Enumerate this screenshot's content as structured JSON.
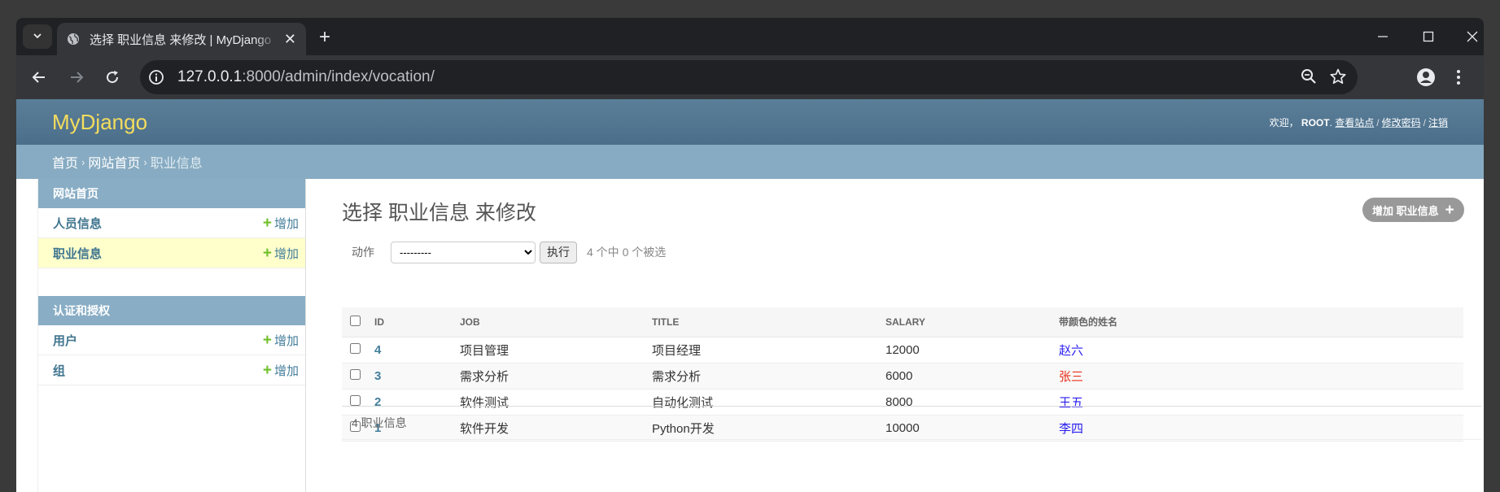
{
  "browser": {
    "tab_title": "选择 职业信息 来修改 | MyDjango",
    "url_host": "127.0.0.1",
    "url_rest": ":8000/admin/index/vocation/"
  },
  "header": {
    "brand": "MyDjango",
    "welcome": "欢迎，",
    "username": "ROOT",
    "view_site": "查看站点",
    "change_password": "修改密码",
    "logout": "注销"
  },
  "breadcrumbs": {
    "home": "首页",
    "app": "网站首页",
    "current": "职业信息"
  },
  "sidebar": {
    "modules": [
      {
        "caption": "网站首页",
        "rows": [
          {
            "label": "人员信息",
            "add": "增加"
          },
          {
            "label": "职业信息",
            "add": "增加"
          }
        ]
      },
      {
        "caption": "认证和授权",
        "rows": [
          {
            "label": "用户",
            "add": "增加"
          },
          {
            "label": "组",
            "add": "增加"
          }
        ]
      }
    ]
  },
  "content": {
    "title": "选择 职业信息 来修改",
    "add_button": "增加 职业信息",
    "action_label": "动作",
    "action_select": "---------",
    "go_button": "执行",
    "selection_counter": "4 个中 0 个被选",
    "columns": [
      "ID",
      "JOB",
      "TITLE",
      "SALARY",
      "带颜色的姓名"
    ],
    "rows": [
      {
        "id": "4",
        "job": "项目管理",
        "title": "项目经理",
        "salary": "12000",
        "name": "赵六",
        "name_color": "#2a1ef0"
      },
      {
        "id": "3",
        "job": "需求分析",
        "title": "需求分析",
        "salary": "6000",
        "name": "张三",
        "name_color": "#e8301c"
      },
      {
        "id": "2",
        "job": "软件测试",
        "title": "自动化测试",
        "salary": "8000",
        "name": "王五",
        "name_color": "#2a1ef0"
      },
      {
        "id": "1",
        "job": "软件开发",
        "title": "Python开发",
        "salary": "10000",
        "name": "李四",
        "name_color": "#2a1ef0"
      }
    ],
    "paginator": "4 职业信息"
  }
}
